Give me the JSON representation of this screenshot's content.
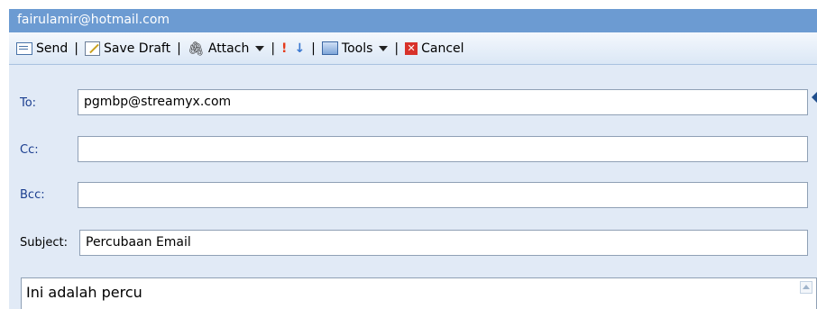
{
  "window": {
    "title": "fairulamir@hotmail.com"
  },
  "toolbar": {
    "send_label": "Send",
    "save_draft_label": "Save Draft",
    "attach_label": "Attach",
    "tools_label": "Tools",
    "cancel_label": "Cancel",
    "separator": "|",
    "icons": {
      "send": "send-icon",
      "save_draft": "save-draft-icon",
      "attach": "paperclip-icon",
      "high_importance": "exclamation-icon",
      "low_importance": "down-arrow-icon",
      "tools": "tools-icon",
      "cancel": "cancel-icon"
    }
  },
  "form": {
    "to_label": "To:",
    "to_value": "pgmbp@streamyx.com",
    "cc_label": "Cc:",
    "cc_value": "",
    "bcc_label": "Bcc:",
    "bcc_value": "",
    "subject_label": "Subject:",
    "subject_value": "Percubaan Email"
  },
  "body": {
    "text": "Ini adalah percu"
  },
  "colors": {
    "titlebar": "#6c9bd2",
    "form_background": "#e1eaf6",
    "label_blue": "#1a3d8f"
  }
}
